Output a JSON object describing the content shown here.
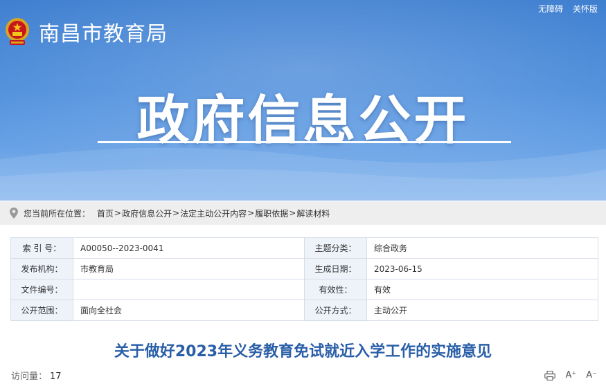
{
  "header": {
    "accessibility_label": "无障碍",
    "elder_mode_label": "关怀版",
    "site_name": "南昌市教育局",
    "banner_title": "政府信息公开"
  },
  "breadcrumb": {
    "prefix": "您当前所在位置：",
    "items": [
      "首页",
      "政府信息公开",
      "法定主动公开内容",
      "履职依据",
      "解读材料"
    ],
    "separator": ">"
  },
  "meta": {
    "rows": [
      {
        "k1": "索 引 号：",
        "v1": "A00050--2023-0041",
        "k2": "主题分类：",
        "v2": "综合政务"
      },
      {
        "k1": "发布机构：",
        "v1": "市教育局",
        "k2": "生成日期：",
        "v2": "2023-06-15"
      },
      {
        "k1": "文件编号：",
        "v1": "",
        "k2": "有效性：",
        "v2": "有效"
      },
      {
        "k1": "公开范围：",
        "v1": "面向全社会",
        "k2": "公开方式：",
        "v2": "主动公开"
      }
    ]
  },
  "document": {
    "title": "关于做好2023年义务教育免试就近入学工作的实施意见",
    "visits_label": "访问量：",
    "visits_value": "17",
    "font_increase": "A⁺",
    "font_decrease": "A⁻"
  },
  "icons": [
    "national-emblem-icon",
    "location-pin-icon",
    "print-icon"
  ]
}
